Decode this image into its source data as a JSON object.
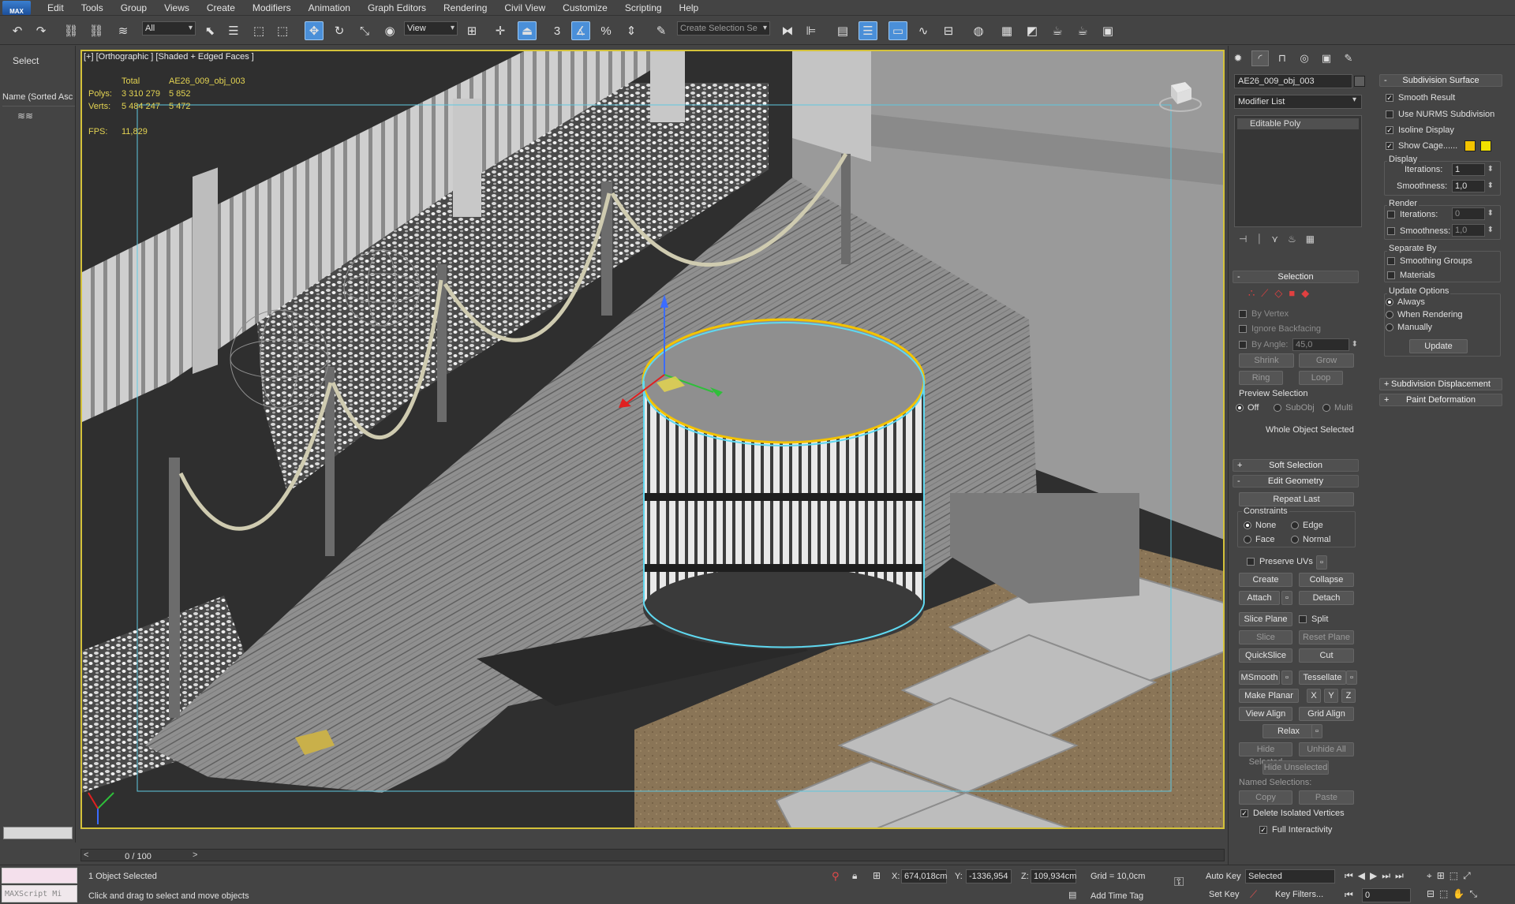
{
  "menubar": {
    "logo": "MAX",
    "items": [
      "Edit",
      "Tools",
      "Group",
      "Views",
      "Create",
      "Modifiers",
      "Animation",
      "Graph Editors",
      "Rendering",
      "Civil View",
      "Customize",
      "Scripting",
      "Help"
    ]
  },
  "toolbar": {
    "filter_value": "All",
    "ref_coord_value": "View",
    "selection_set_placeholder": "Create Selection Se",
    "snap_label": "3",
    "icons": [
      "undo-icon",
      "redo-icon",
      "link-icon",
      "unlink-icon",
      "bind-spacewarp-icon",
      "select-object-icon",
      "select-by-name-icon",
      "rect-region-icon",
      "window-crossing-icon",
      "move-icon",
      "rotate-icon",
      "scale-icon",
      "placement-icon",
      "pivot-icon",
      "manipulate-icon",
      "keyboard-shortcut-icon",
      "snaps-toggle-icon",
      "angle-snap-icon",
      "percent-snap-icon",
      "spinner-snap-icon",
      "edit-named-sets-icon",
      "mirror-icon",
      "align-icon",
      "scene-explorer-icon",
      "layer-explorer-icon",
      "toggle-ribbon-icon",
      "curve-editor-icon",
      "schematic-view-icon",
      "material-editor-icon",
      "render-setup-icon",
      "rendered-frame-icon",
      "render-production-icon",
      "render-iterative-icon",
      "a360-icon"
    ]
  },
  "left_panel": {
    "select_label": "Select",
    "scene_explorer_header": "Name (Sorted Asc"
  },
  "viewport": {
    "label": "[+] [Orthographic ] [Shaded + Edged Faces ]",
    "stats": {
      "total_label": "Total",
      "object_name": "AE26_009_obj_003",
      "polys_label": "Polys:",
      "polys_total": "3 310 279",
      "polys_sel": "5 852",
      "verts_label": "Verts:",
      "verts_total": "5 484 247",
      "verts_sel": "5 472",
      "fps_label": "FPS:",
      "fps_value": "11,829"
    }
  },
  "timeline": {
    "frame_label": "0 / 100"
  },
  "status": {
    "maxscript": "MAXScript Mi",
    "selected_count": "1 Object Selected",
    "prompt": "Click and drag to select and move objects",
    "x_label": "X:",
    "x_value": "674,018cm",
    "y_label": "Y:",
    "y_value": "-1336,954",
    "z_label": "Z:",
    "z_value": "109,934cm",
    "grid": "Grid = 10,0cm",
    "add_time_tag": "Add Time Tag",
    "auto_key": "Auto Key",
    "set_key": "Set Key",
    "selected_dropdown": "Selected",
    "key_filters": "Key Filters...",
    "frame_field": "0"
  },
  "command_panel": {
    "object_name": "AE26_009_obj_003",
    "modifier_list": "Modifier List",
    "stack_item": "Editable Poly",
    "selection": {
      "title": "Selection",
      "by_vertex": "By Vertex",
      "ignore_backfacing": "Ignore Backfacing",
      "by_angle": "By Angle:",
      "angle_value": "45,0",
      "shrink": "Shrink",
      "grow": "Grow",
      "ring": "Ring",
      "loop": "Loop",
      "preview_label": "Preview Selection",
      "preview_off": "Off",
      "preview_subobj": "SubObj",
      "preview_multi": "Multi",
      "whole_object": "Whole Object Selected"
    },
    "soft_selection": "Soft Selection",
    "edit_geometry": {
      "title": "Edit Geometry",
      "repeat_last": "Repeat Last",
      "constraints": "Constraints",
      "none": "None",
      "edge": "Edge",
      "face": "Face",
      "normal": "Normal",
      "preserve_uvs": "Preserve UVs",
      "create": "Create",
      "collapse": "Collapse",
      "attach": "Attach",
      "detach": "Detach",
      "slice_plane": "Slice Plane",
      "split": "Split",
      "slice": "Slice",
      "reset_plane": "Reset Plane",
      "quickslice": "QuickSlice",
      "cut": "Cut",
      "msmooth": "MSmooth",
      "tessellate": "Tessellate",
      "make_planar": "Make Planar",
      "x": "X",
      "y": "Y",
      "z": "Z",
      "view_align": "View Align",
      "grid_align": "Grid Align",
      "relax": "Relax",
      "hide_selected": "Hide Selected",
      "unhide_all": "Unhide All",
      "hide_unselected": "Hide Unselected",
      "named_selections": "Named Selections:",
      "copy": "Copy",
      "paste": "Paste",
      "delete_isolated": "Delete Isolated Vertices",
      "full_interactivity": "Full Interactivity"
    },
    "subdivision_surface": {
      "title": "Subdivision Surface",
      "smooth_result": "Smooth Result",
      "use_nurms": "Use NURMS Subdivision",
      "isoline_display": "Isoline Display",
      "show_cage": "Show Cage......",
      "display_label": "Display",
      "iterations_label": "Iterations:",
      "display_iterations": "1",
      "smoothness_label": "Smoothness:",
      "display_smoothness": "1,0",
      "render_label": "Render",
      "render_iterations": "0",
      "render_smoothness": "1,0",
      "separate_by": "Separate By",
      "smoothing_groups": "Smoothing Groups",
      "materials": "Materials",
      "update_options": "Update Options",
      "always": "Always",
      "when_rendering": "When Rendering",
      "manually": "Manually",
      "update": "Update"
    },
    "subdivision_displacement": "Subdivision Displacement",
    "paint_deformation": "Paint Deformation"
  },
  "colors": {
    "accent_blue": "#4a8fd8",
    "viewport_border": "#d4c23a",
    "stats_text": "#e3d352",
    "cage_yellow": "#f3c300",
    "selection_cyan": "#5fd8f0"
  }
}
